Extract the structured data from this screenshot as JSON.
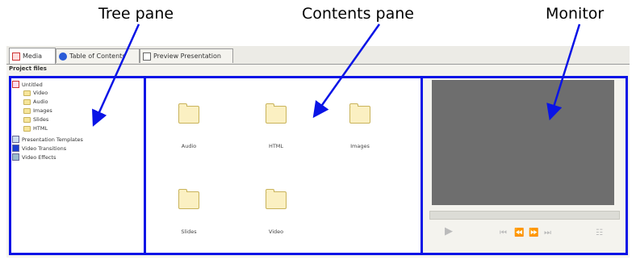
{
  "callouts": {
    "tree": "Tree pane",
    "contents": "Contents pane",
    "monitor": "Monitor"
  },
  "tabs": [
    {
      "label": "Media",
      "icon": "media-icon",
      "active": true
    },
    {
      "label": "Table of Contents",
      "icon": "info-icon",
      "active": false
    },
    {
      "label": "Preview Presentation",
      "icon": "preview-icon",
      "active": false
    }
  ],
  "section_label": "Project files",
  "tree": {
    "root": "Untitled",
    "children": [
      "Video",
      "Audio",
      "Images",
      "Slides",
      "HTML"
    ],
    "others": [
      "Presentation Templates",
      "Video Transitions",
      "Video Effects"
    ]
  },
  "contents": [
    "Audio",
    "HTML",
    "Images",
    "Slides",
    "Video"
  ],
  "accent_color": "#0a14e6"
}
